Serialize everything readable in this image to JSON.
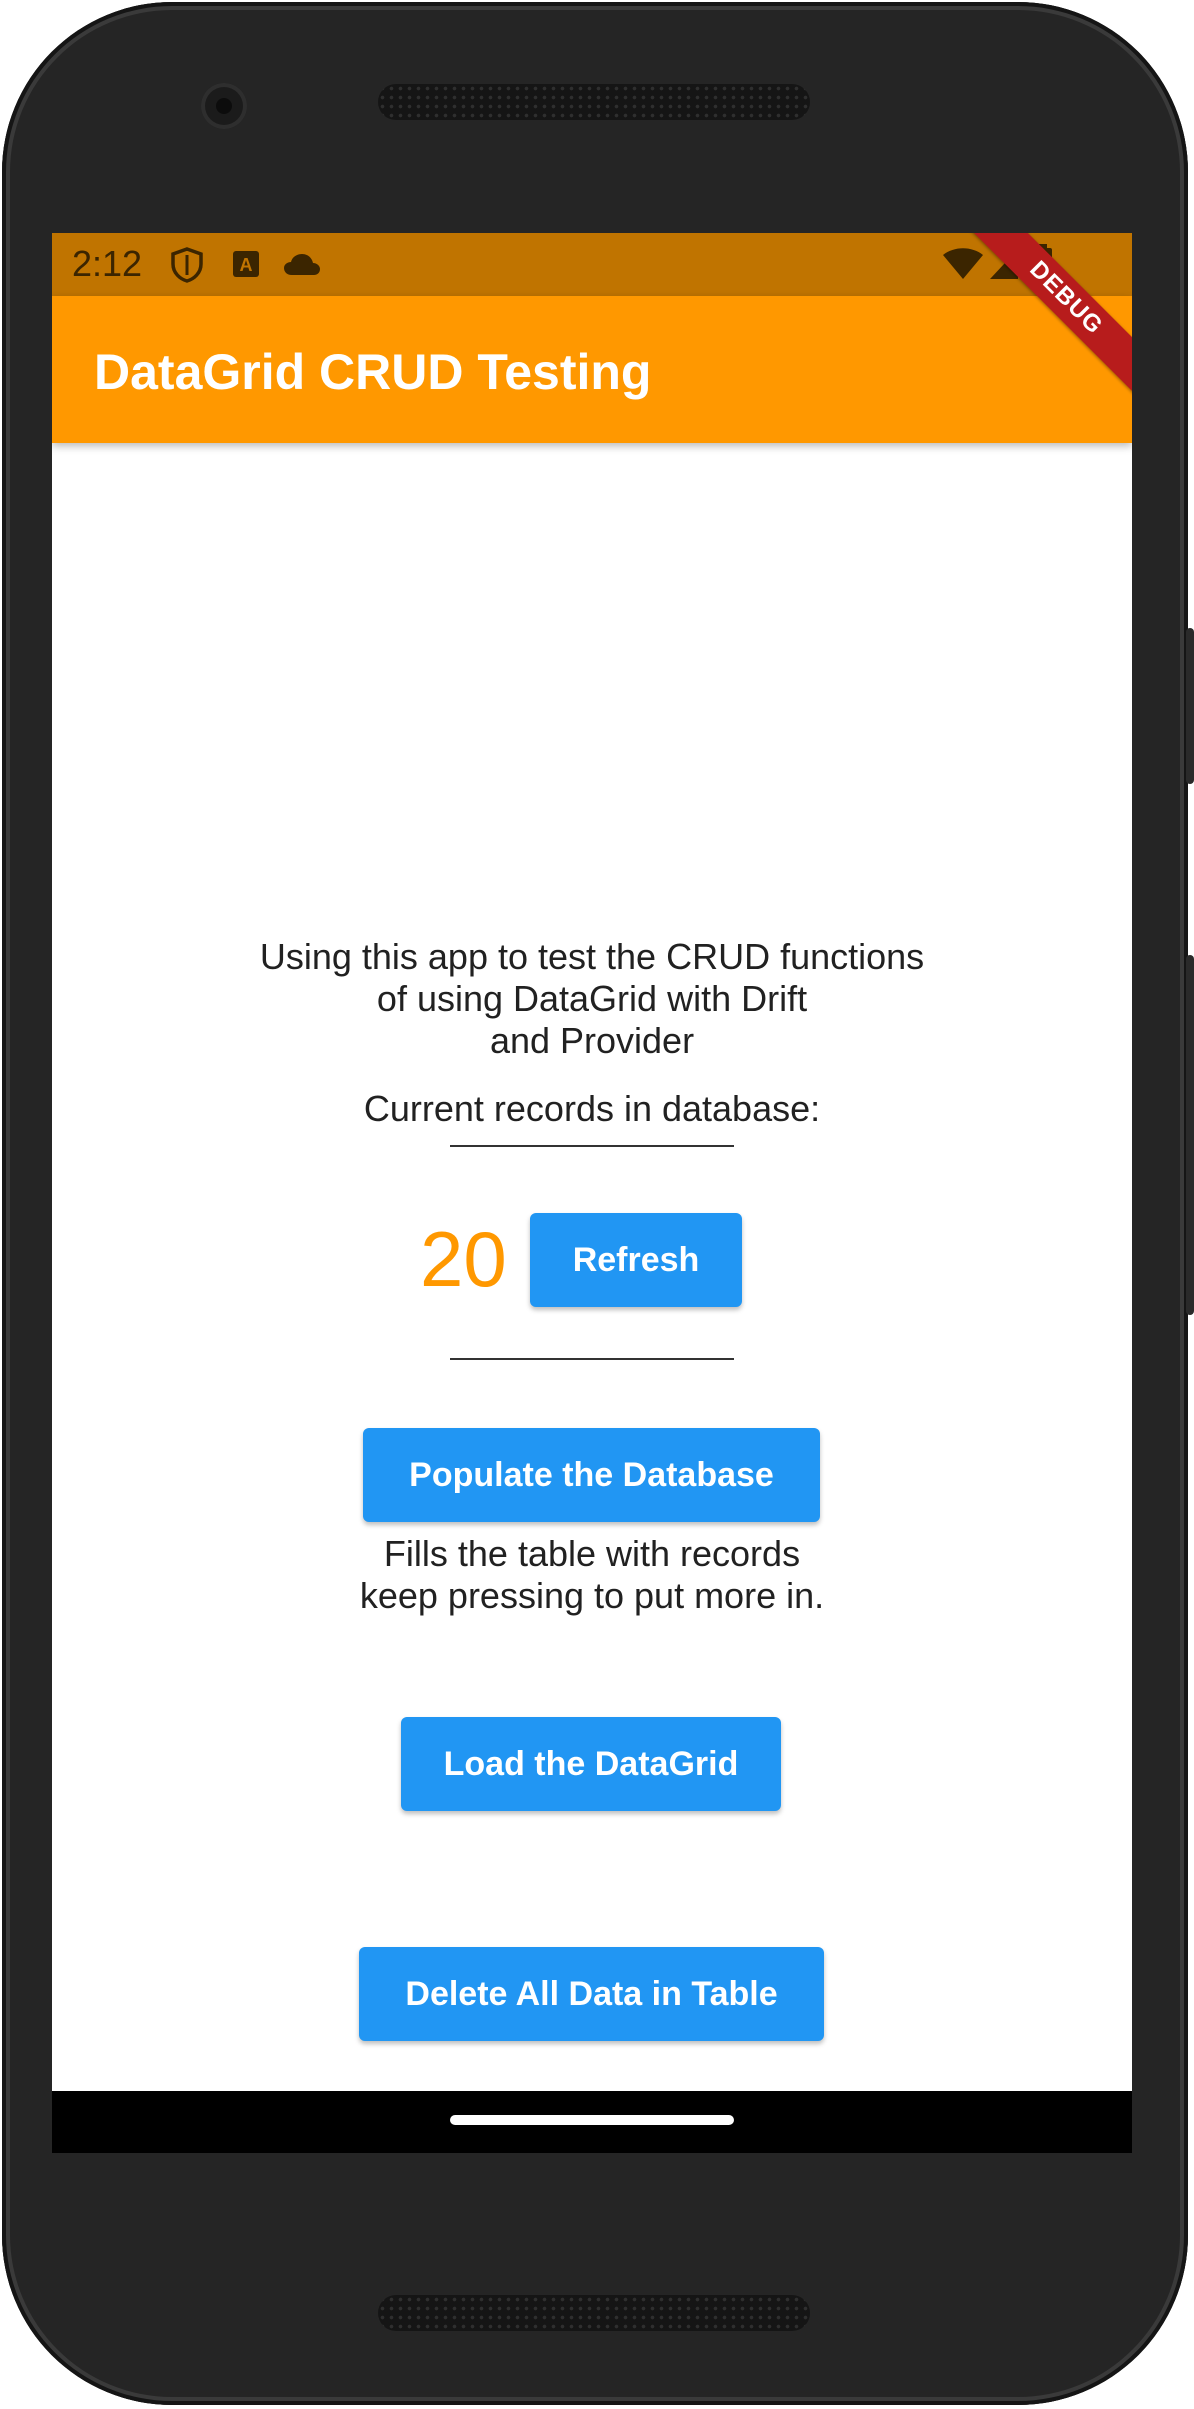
{
  "status_bar": {
    "time": "2:12",
    "icons": [
      "shield-icon",
      "a-badge-icon",
      "cloud-icon",
      "wifi-icon",
      "signal-icon",
      "battery-icon"
    ],
    "color": "#c07400"
  },
  "app_bar": {
    "title": "DataGrid CRUD Testing",
    "color": "#ff9800"
  },
  "debug_banner": "DEBUG",
  "main": {
    "intro_lines": [
      "Using this app to test the CRUD functions",
      "of using DataGrid with Drift",
      "and Provider"
    ],
    "records_label": "Current records in database:",
    "records_count": "20",
    "refresh_label": "Refresh",
    "populate_label": "Populate the Database",
    "populate_help_lines": [
      "Fills the table with records",
      "keep pressing to put more in."
    ],
    "load_label": "Load the DataGrid",
    "delete_label": "Delete All Data in Table"
  },
  "colors": {
    "accent": "#ff9800",
    "button": "#2196f3"
  }
}
